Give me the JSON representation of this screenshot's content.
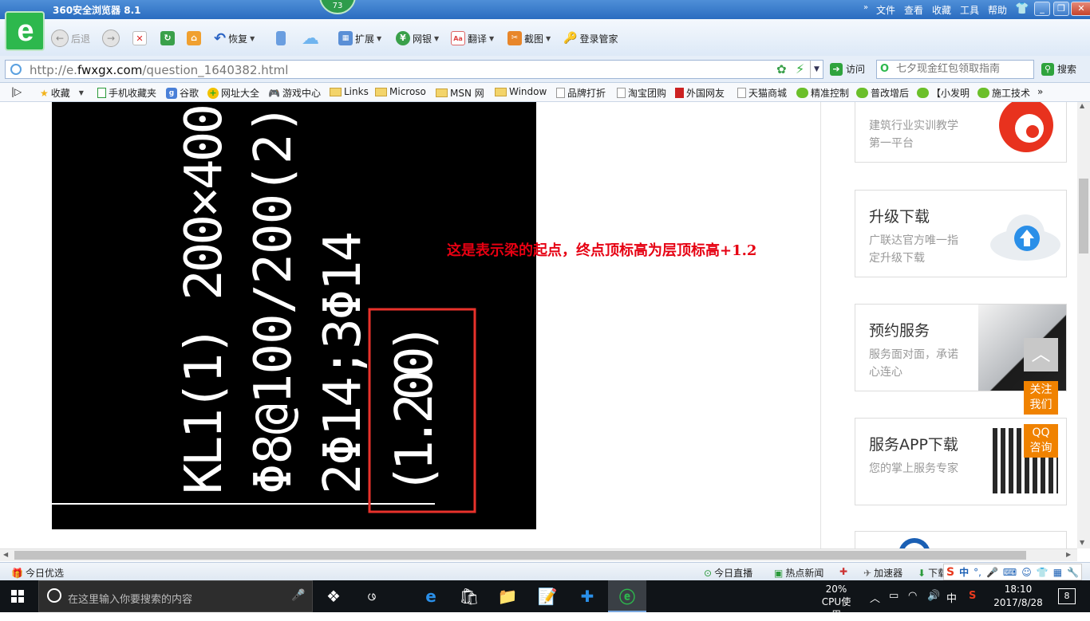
{
  "browser": {
    "title": "360安全浏览器 8.1",
    "menu": [
      "文件",
      "查看",
      "收藏",
      "工具",
      "帮助"
    ],
    "badge": "73"
  },
  "toolbar": {
    "back": "后退",
    "restore": "恢复",
    "extend": "扩展",
    "bank": "网银",
    "translate": "翻译",
    "screenshot": "截图",
    "login_manager": "登录管家"
  },
  "address": {
    "url_prefix": "http://e.",
    "url_domain": "fwxgx.com",
    "url_path": "/question_1640382.html",
    "go_label": "访问",
    "search_placeholder": "七夕现金红包领取指南",
    "search_label": "搜索"
  },
  "favorites": [
    "收藏",
    "手机收藏夹",
    "谷歌",
    "网址大全",
    "游戏中心",
    "Links",
    "Microso",
    "MSN 网",
    "Window",
    "品牌打折",
    "淘宝团购",
    "外国网友",
    "天猫商城",
    "精准控制",
    "普改增后",
    "【小发明",
    "施工技术"
  ],
  "content": {
    "cad_text": {
      "line1": "KL1(1) 200×400",
      "line2": "Φ8@100/200(2)",
      "line3": "2Φ14;3Φ14",
      "line4": "(1.200)"
    },
    "annotation": "这是表示梁的起点，终点顶标高为层顶标高+1.2",
    "sidebar_cards": [
      {
        "title": "",
        "desc": "建筑行业实训教学第一平台"
      },
      {
        "title": "升级下载",
        "desc": "广联达官方唯一指定升级下载"
      },
      {
        "title": "预约服务",
        "desc": "服务面对面，承诺心连心"
      },
      {
        "title": "服务APP下载",
        "desc": "您的掌上服务专家"
      }
    ],
    "follow_us": "关注我们",
    "qq_consult": "QQ咨询"
  },
  "statusbar": {
    "left": "今日优选",
    "live": "今日直播",
    "hot_news": "热点新闻",
    "accelerator": "加速器",
    "download": "下载",
    "ime": "中"
  },
  "taskbar": {
    "search_placeholder": "在这里输入你要搜索的内容",
    "cpu_percent": "20%",
    "cpu_label": "CPU使用",
    "ime": "中",
    "time": "18:10",
    "date": "2017/8/28",
    "notifications": "8"
  },
  "colors": {
    "annotation": "#e60012",
    "orange_btn": "#f08200",
    "highlight_box": "#e8322b"
  }
}
